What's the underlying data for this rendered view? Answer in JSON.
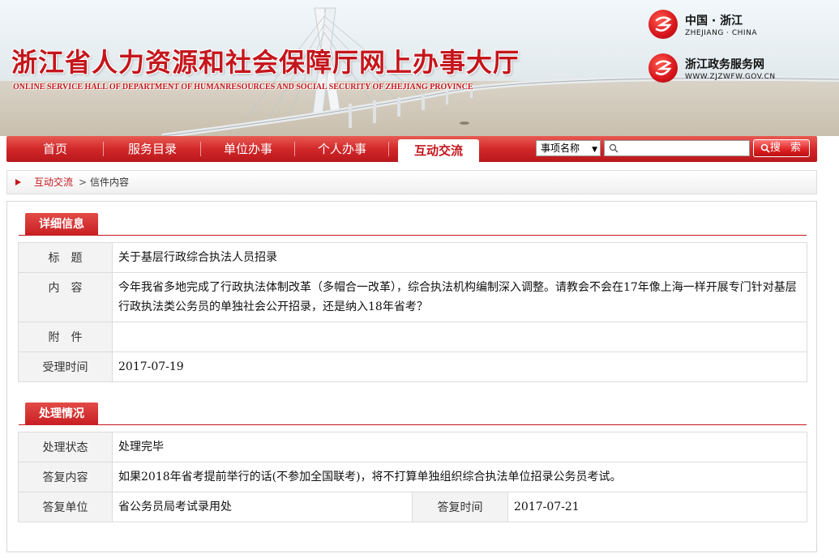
{
  "header": {
    "title": "浙江省人力资源和社会保障厅网上办事大厅",
    "subtitle": "ONLINE SERVICE HALL OF DEPARTMENT OF HUMANRESOURCES AND SOCIAL SECURITY OF ZHEJIANG PROVINCE",
    "logos": [
      {
        "cn": "中国 · 浙江",
        "en": "ZHEJIANG · CHINA",
        "icon": "zhejiang-emblem-icon"
      },
      {
        "cn": "浙江政务服务网",
        "en": "WWW.ZJZWFW.GOV.CN",
        "icon": "zjzwfw-emblem-icon"
      }
    ]
  },
  "nav": {
    "items": [
      {
        "label": "首页"
      },
      {
        "label": "服务目录"
      },
      {
        "label": "单位办事"
      },
      {
        "label": "个人办事"
      },
      {
        "label": "互动交流",
        "active": true
      }
    ],
    "search": {
      "select_value": "事项名称",
      "input_value": "",
      "button_label": "搜 索"
    }
  },
  "breadcrumb": {
    "link": "互动交流",
    "separator": ">",
    "current": "信件内容"
  },
  "detail": {
    "heading": "详细信息",
    "rows": {
      "title": {
        "label": "标　题",
        "value": "关于基层行政综合执法人员招录"
      },
      "content": {
        "label": "内　容",
        "value": "今年我省多地完成了行政执法体制改革（多帽合一改革），综合执法机构编制深入调整。请教会不会在17年像上海一样开展专门针对基层行政执法类公务员的单独社会公开招录，还是纳入18年省考？"
      },
      "attachment": {
        "label": "附　件",
        "value": ""
      },
      "received": {
        "label": "受理时间",
        "value": "2017-07-19"
      }
    }
  },
  "handling": {
    "heading": "处理情况",
    "rows": {
      "status": {
        "label": "处理状态",
        "value": "处理完毕"
      },
      "reply": {
        "label": "答复内容",
        "value": "如果2018年省考提前举行的话(不参加全国联考)，将不打算单独组织综合执法单位招录公务员考试。"
      },
      "unit": {
        "label": "答复单位",
        "value": "省公务员局考试录用处"
      },
      "reply_time": {
        "label": "答复时间",
        "value": "2017-07-21"
      }
    }
  },
  "colors": {
    "brand_red": "#c4161c",
    "label_bg": "#f3f3f3",
    "border": "#dcdcdc"
  }
}
